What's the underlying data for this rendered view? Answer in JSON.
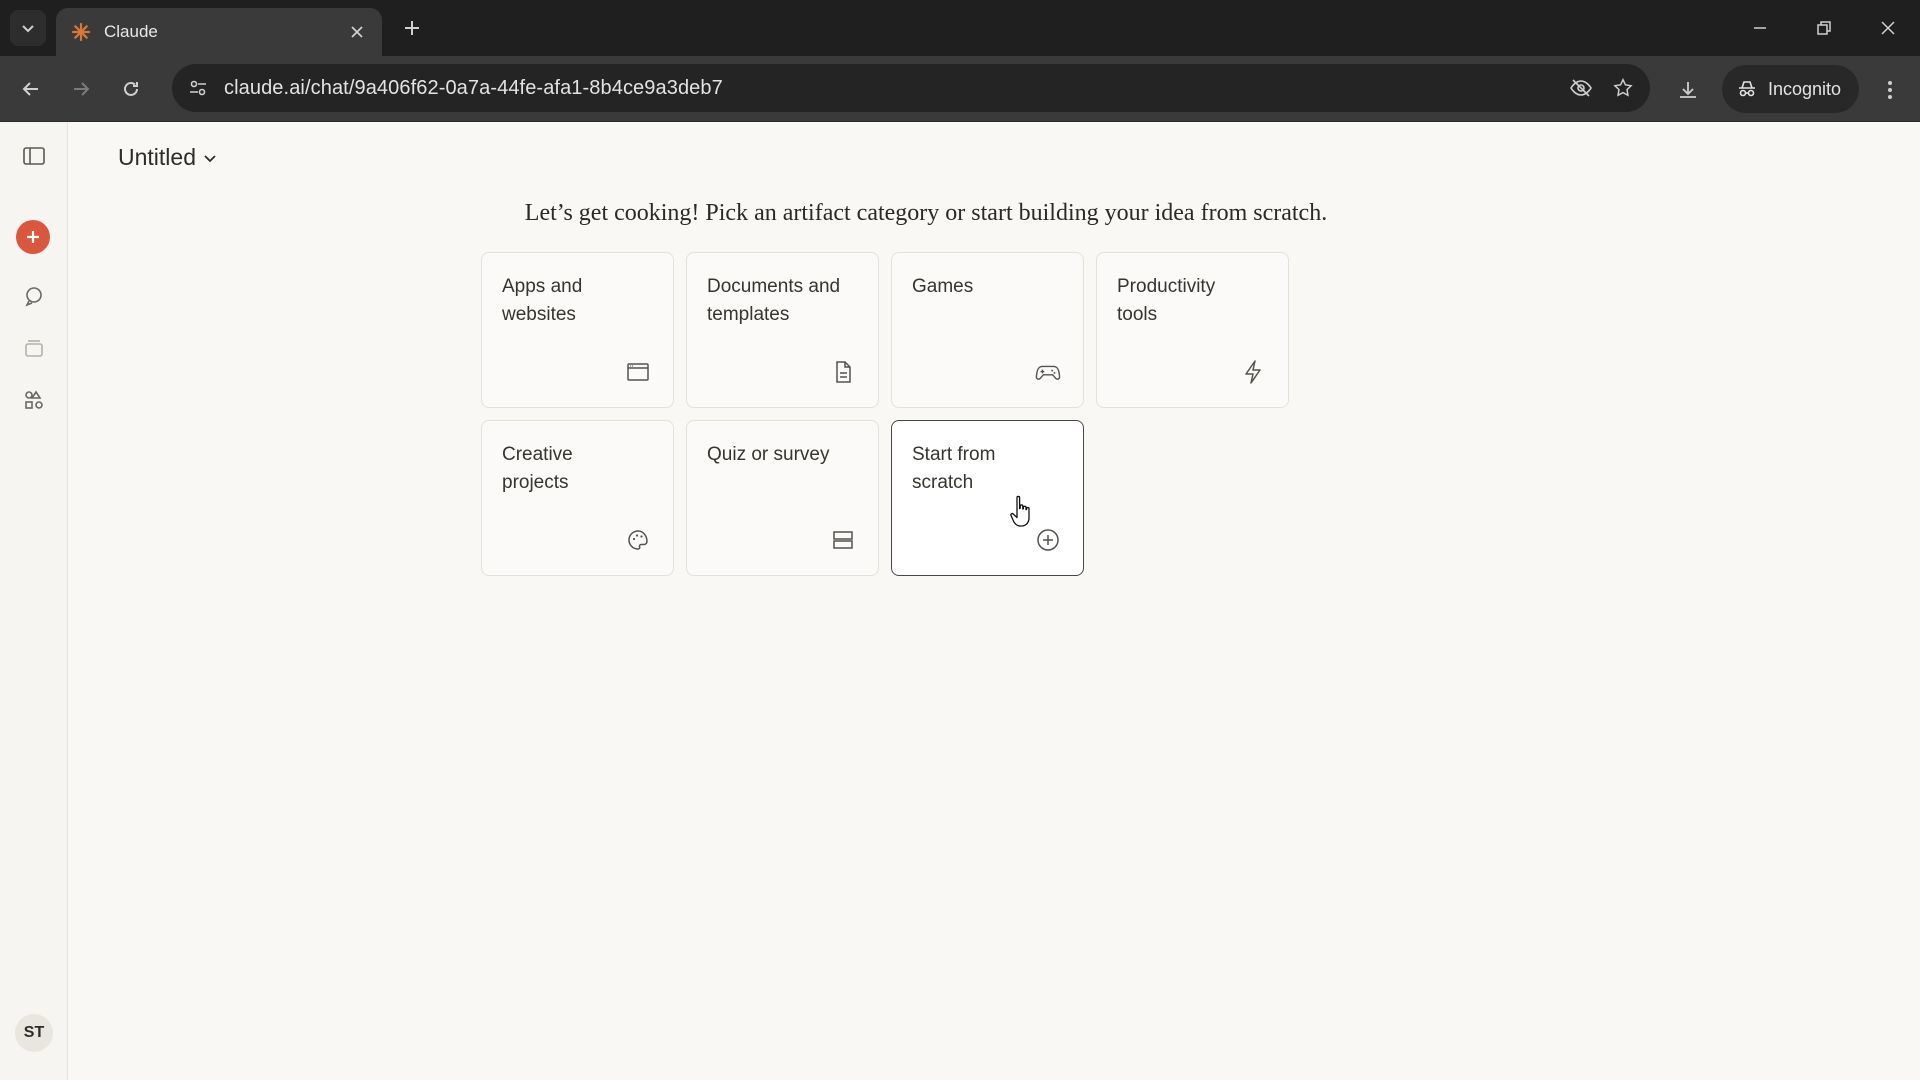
{
  "browser": {
    "tab_title": "Claude",
    "url": "claude.ai/chat/9a406f62-0a7a-44fe-afa1-8b4ce9a3deb7",
    "incognito_label": "Incognito"
  },
  "sidebar": {
    "avatar_initials": "ST"
  },
  "main": {
    "doc_title": "Untitled",
    "prompt": "Let’s get cooking! Pick an artifact category or start building your idea from scratch.",
    "cards": [
      {
        "label": "Apps and websites",
        "icon": "browser-window-icon"
      },
      {
        "label": "Documents and templates",
        "icon": "document-icon"
      },
      {
        "label": "Games",
        "icon": "gamepad-icon"
      },
      {
        "label": "Productivity tools",
        "icon": "lightning-icon"
      },
      {
        "label": "Creative projects",
        "icon": "palette-icon"
      },
      {
        "label": "Quiz or survey",
        "icon": "list-rows-icon"
      },
      {
        "label": "Start from scratch",
        "icon": "plus-circle-icon"
      }
    ]
  },
  "colors": {
    "accent": "#d9573d",
    "page_bg": "#f9f8f5",
    "chrome_dark": "#1f1f1f",
    "chrome_toolbar": "#3a3a3a"
  }
}
